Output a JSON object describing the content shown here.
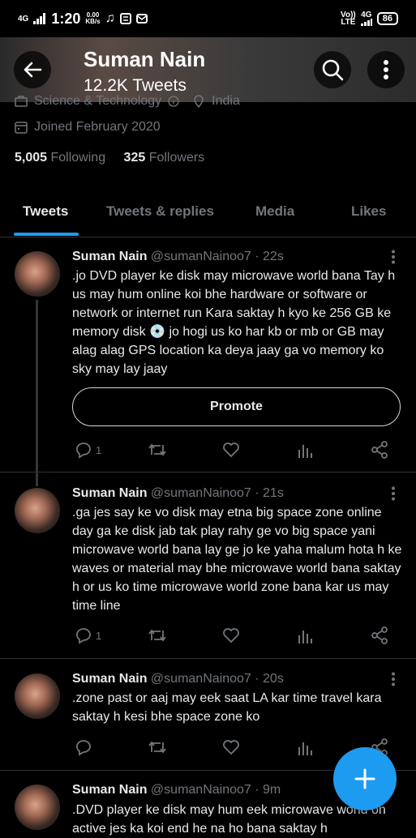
{
  "status_bar": {
    "network_left": "4G",
    "time": "1:20",
    "speed_value": "0.00",
    "speed_unit": "KB/s",
    "network_right_top": "Vo))",
    "network_right_bottom": "LTE",
    "network_right": "4G",
    "battery": "86"
  },
  "header": {
    "name": "Suman Nain",
    "tweet_count": "12.2K Tweets"
  },
  "profile": {
    "category": "Science & Technology",
    "location": "India",
    "joined": "Joined February 2020",
    "following_count": "5,005",
    "following_label": "Following",
    "followers_count": "325",
    "followers_label": "Followers"
  },
  "tabs": [
    {
      "label": "Tweets"
    },
    {
      "label": "Tweets & replies"
    },
    {
      "label": "Media"
    },
    {
      "label": "Likes"
    }
  ],
  "tweets": [
    {
      "name": "Suman Nain",
      "handle": "@sumanNainoo7",
      "time": "· 22s",
      "text": ".jo DVD player ke disk may microwave world bana Tay h us may hum online koi bhe hardware or software or network or internet run Kara saktay h kyo ke 256 GB ke memory disk 💿 jo hogi us ko har kb or mb or GB may alag alag GPS location ka deya jaay ga vo memory ko sky may lay jaay",
      "promote": "Promote",
      "replies": "1"
    },
    {
      "name": "Suman Nain",
      "handle": "@sumanNainoo7",
      "time": "· 21s",
      "text": ".ga jes say ke vo disk may etna big space zone online day ga ke disk jab tak play rahy ge vo big space yani microwave world bana lay ge jo ke yaha malum hota h ke waves or material may bhe microwave world bana saktay h or us ko time microwave world zone bana kar us may time line",
      "replies": "1"
    },
    {
      "name": "Suman Nain",
      "handle": "@sumanNainoo7",
      "time": "· 20s",
      "text": ".zone past or aaj may eek saat LA kar time travel kara saktay h kesi bhe space zone ko",
      "replies": ""
    },
    {
      "name": "Suman Nain",
      "handle": "@sumanNainoo7",
      "time": "· 9m",
      "text": ".DVD player ke disk may hum eek microwave world on active jes ka koi end he na ho bana saktay h"
    }
  ],
  "colors": {
    "accent": "#1d9bf0",
    "muted": "#71767b",
    "background": "#000000"
  }
}
